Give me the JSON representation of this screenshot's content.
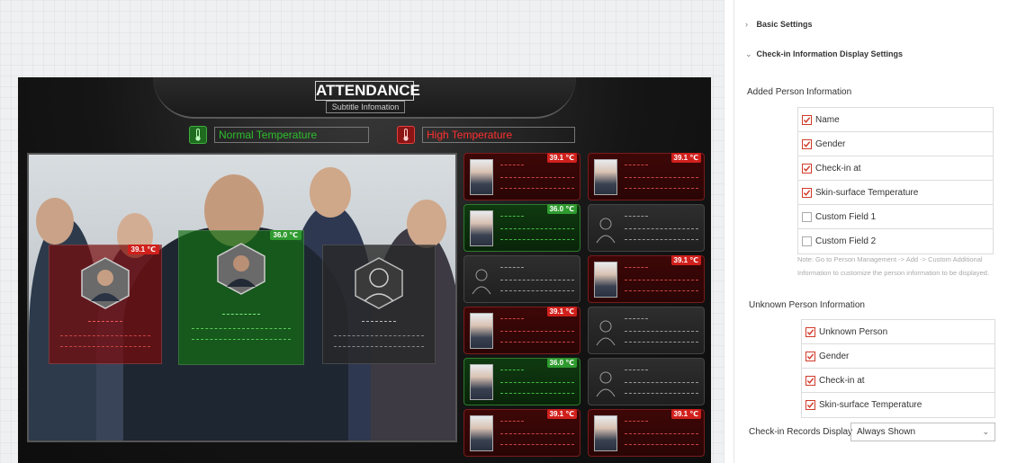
{
  "screen": {
    "title": "ATTENDANCE",
    "subtitle": "Subtitle Infomation",
    "normal_label": "Normal Temperature",
    "high_label": "High Temperature",
    "normal_color": "#2fbf2f",
    "high_color": "#ff3030"
  },
  "photo_cards": [
    {
      "state": "red",
      "temp": "39.1 ℃"
    },
    {
      "state": "green",
      "temp": "36.0 ℃"
    },
    {
      "state": "gray",
      "temp": ""
    }
  ],
  "grid_cards": [
    {
      "state": "red",
      "temp": "39.1 ℃",
      "photo": true
    },
    {
      "state": "red",
      "temp": "39.1 ℃",
      "photo": true
    },
    {
      "state": "green",
      "temp": "36.0 ℃",
      "photo": true
    },
    {
      "state": "gray",
      "temp": "",
      "photo": false
    },
    {
      "state": "gray",
      "temp": "",
      "photo": false
    },
    {
      "state": "red",
      "temp": "39.1 ℃",
      "photo": true
    },
    {
      "state": "red",
      "temp": "39.1 ℃",
      "photo": true
    },
    {
      "state": "gray",
      "temp": "",
      "photo": false
    },
    {
      "state": "green",
      "temp": "36.0 ℃",
      "photo": true
    },
    {
      "state": "gray",
      "temp": "",
      "photo": false
    },
    {
      "state": "red",
      "temp": "39.1 ℃",
      "photo": true
    },
    {
      "state": "red",
      "temp": "39.1 ℃",
      "photo": true
    }
  ],
  "panel": {
    "basic_settings": "Basic Settings",
    "checkin_display_settings": "Check-in Information Display Settings",
    "added_person_info": "Added Person Information",
    "added_options": [
      {
        "label": "Name",
        "checked": true
      },
      {
        "label": "Gender",
        "checked": true
      },
      {
        "label": "Check-in at",
        "checked": true
      },
      {
        "label": "Skin-surface Temperature",
        "checked": true
      },
      {
        "label": "Custom Field 1",
        "checked": false
      },
      {
        "label": "Custom Field 2",
        "checked": false
      }
    ],
    "note": "Note: Go to Person Management -> Add -> Custom Additional Information to customize the person information to be displayed.",
    "unknown_person_info": "Unknown Person Information",
    "unknown_options": [
      {
        "label": "Unknown Person",
        "checked": true
      },
      {
        "label": "Gender",
        "checked": true
      },
      {
        "label": "Check-in at",
        "checked": true
      },
      {
        "label": "Skin-surface Temperature",
        "checked": true
      }
    ],
    "records_display_label": "Check-in Records Display",
    "records_display_value": "Always Shown"
  }
}
